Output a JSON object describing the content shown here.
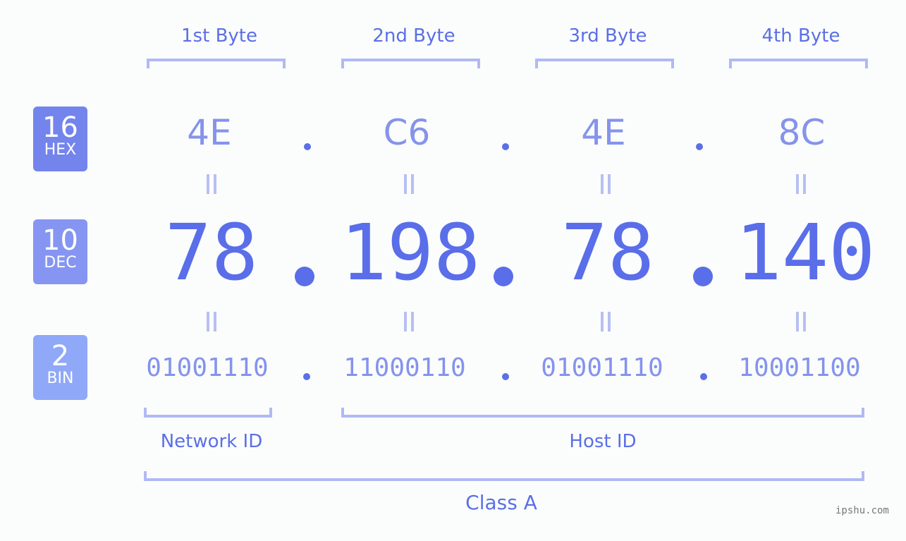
{
  "bytes": [
    {
      "label": "1st Byte",
      "hex": "4E",
      "dec": "78",
      "bin": "01001110"
    },
    {
      "label": "2nd Byte",
      "hex": "C6",
      "dec": "198",
      "bin": "11000110"
    },
    {
      "label": "3rd Byte",
      "hex": "4E",
      "dec": "78",
      "bin": "01001110"
    },
    {
      "label": "4th Byte",
      "hex": "8C",
      "dec": "140",
      "bin": "10001100"
    }
  ],
  "badges": {
    "hex": {
      "num": "16",
      "label": "HEX",
      "color": "#7384ec"
    },
    "dec": {
      "num": "10",
      "label": "DEC",
      "color": "#8595f1"
    },
    "bin": {
      "num": "2",
      "label": "BIN",
      "color": "#8fa8f8"
    }
  },
  "sections": {
    "network": "Network ID",
    "host": "Host ID",
    "class": "Class A"
  },
  "watermark": "ipshu.com",
  "colors": {
    "primary": "#5a6eea",
    "light": "#8593ec",
    "bracket": "#b1b9f5",
    "background": "#fbfdfc"
  }
}
